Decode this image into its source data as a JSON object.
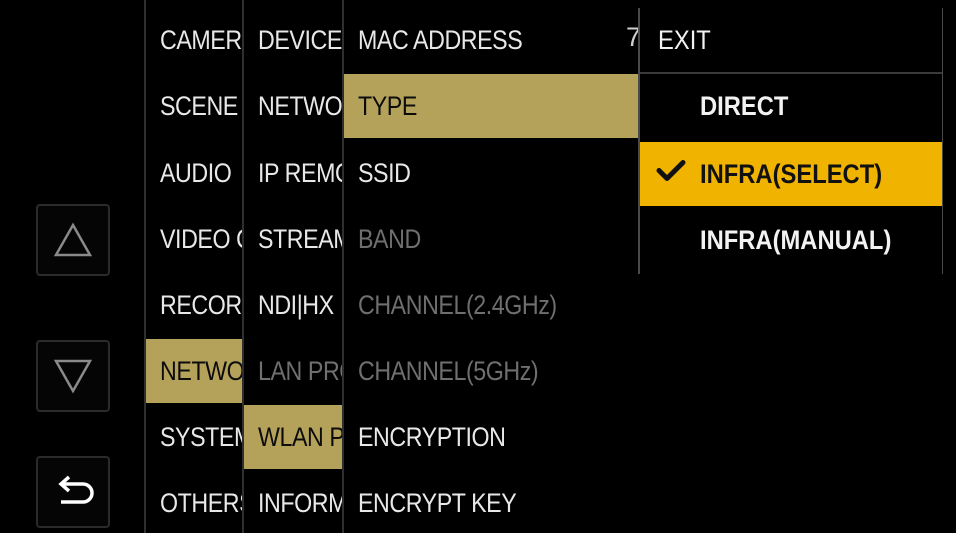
{
  "nav": {
    "up_icon": "triangle-up-icon",
    "down_icon": "triangle-down-icon",
    "back_icon": "return-arrow-icon"
  },
  "menu_level1": [
    {
      "label": "CAMERA"
    },
    {
      "label": "SCENE"
    },
    {
      "label": "AUDIO"
    },
    {
      "label": "VIDEO OUT"
    },
    {
      "label": "RECORDING"
    },
    {
      "label": "NETWORK"
    },
    {
      "label": "SYSTEM"
    },
    {
      "label": "OTHERS"
    }
  ],
  "menu_level2": [
    {
      "label": "DEVICE"
    },
    {
      "label": "NETWORK"
    },
    {
      "label": "IP REMOTE"
    },
    {
      "label": "STREAMING"
    },
    {
      "label": "NDI|HX"
    },
    {
      "label": "LAN PROPERTY"
    },
    {
      "label": "WLAN PROPERTY"
    },
    {
      "label": "INFORMATION"
    }
  ],
  "menu_level3": [
    {
      "label": "MAC ADDRESS"
    },
    {
      "label": "TYPE"
    },
    {
      "label": "SSID"
    },
    {
      "label": "BAND"
    },
    {
      "label": "CHANNEL(2.4GHz)"
    },
    {
      "label": "CHANNEL(5GHz)"
    },
    {
      "label": "ENCRYPTION"
    },
    {
      "label": "ENCRYPT KEY"
    }
  ],
  "mac_value_fragment": "7",
  "popup": {
    "items": [
      {
        "label": "EXIT"
      },
      {
        "label": "DIRECT"
      },
      {
        "label": "INFRA(SELECT)",
        "checked": true
      },
      {
        "label": "INFRA(MANUAL)"
      }
    ],
    "check_icon": "checkmark-icon"
  },
  "colors": {
    "selected_path": "#b5a25a",
    "selected_option": "#f0b400",
    "background": "#000000",
    "text": "#e8e8e8",
    "disabled_text": "#6f6f6f"
  }
}
